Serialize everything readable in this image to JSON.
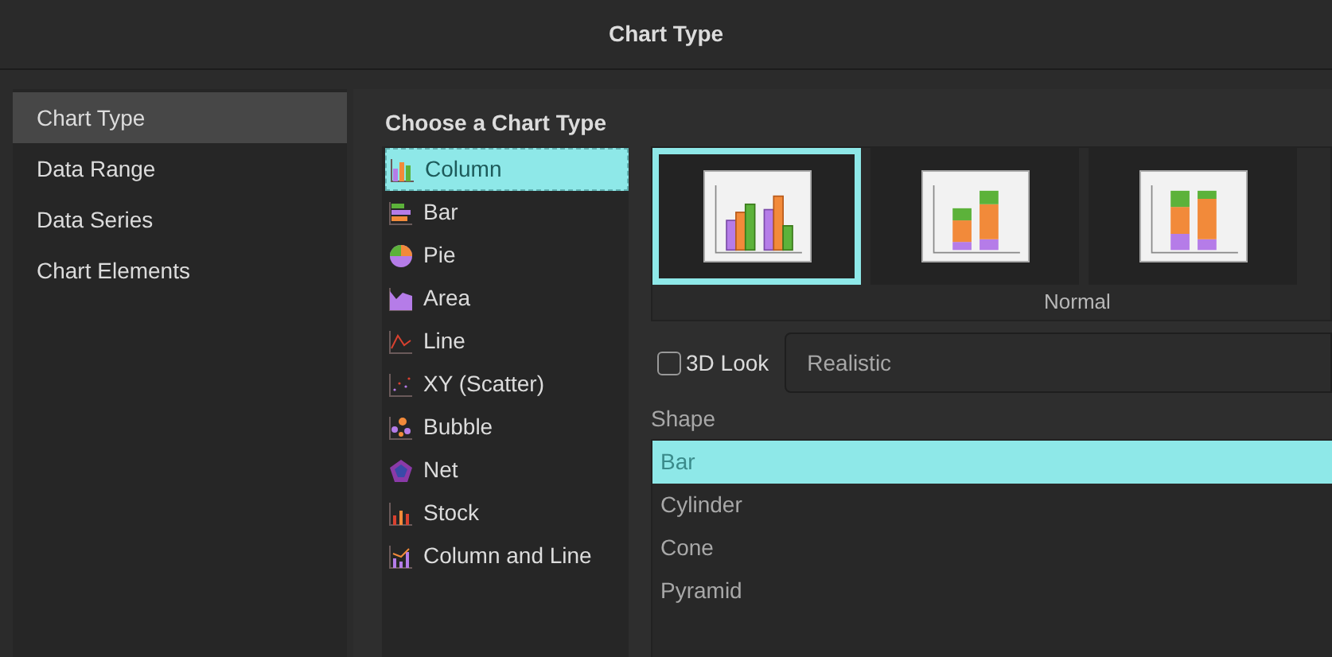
{
  "window": {
    "title": "Chart Type"
  },
  "sidebar": {
    "items": [
      {
        "label": "Chart Type",
        "selected": true
      },
      {
        "label": "Data Range",
        "selected": false
      },
      {
        "label": "Data Series",
        "selected": false
      },
      {
        "label": "Chart Elements",
        "selected": false
      }
    ]
  },
  "heading": "Choose a Chart Type",
  "chart_types": [
    {
      "label": "Column",
      "kind": "column",
      "selected": true
    },
    {
      "label": "Bar",
      "kind": "bar",
      "selected": false
    },
    {
      "label": "Pie",
      "kind": "pie",
      "selected": false
    },
    {
      "label": "Area",
      "kind": "area",
      "selected": false
    },
    {
      "label": "Line",
      "kind": "line",
      "selected": false
    },
    {
      "label": "XY (Scatter)",
      "kind": "scatter",
      "selected": false
    },
    {
      "label": "Bubble",
      "kind": "bubble",
      "selected": false
    },
    {
      "label": "Net",
      "kind": "net",
      "selected": false
    },
    {
      "label": "Stock",
      "kind": "stock",
      "selected": false
    },
    {
      "label": "Column and Line",
      "kind": "combo",
      "selected": false
    }
  ],
  "variants": [
    {
      "kind": "clustered",
      "selected": true
    },
    {
      "kind": "stacked",
      "selected": false
    },
    {
      "kind": "percent",
      "selected": false
    }
  ],
  "variant_label": "Normal",
  "look_3d": {
    "label": "3D Look",
    "checked": false,
    "value": "Realistic"
  },
  "shape": {
    "label": "Shape",
    "options": [
      {
        "label": "Bar",
        "selected": true
      },
      {
        "label": "Cylinder",
        "selected": false
      },
      {
        "label": "Cone",
        "selected": false
      },
      {
        "label": "Pyramid",
        "selected": false
      }
    ]
  }
}
